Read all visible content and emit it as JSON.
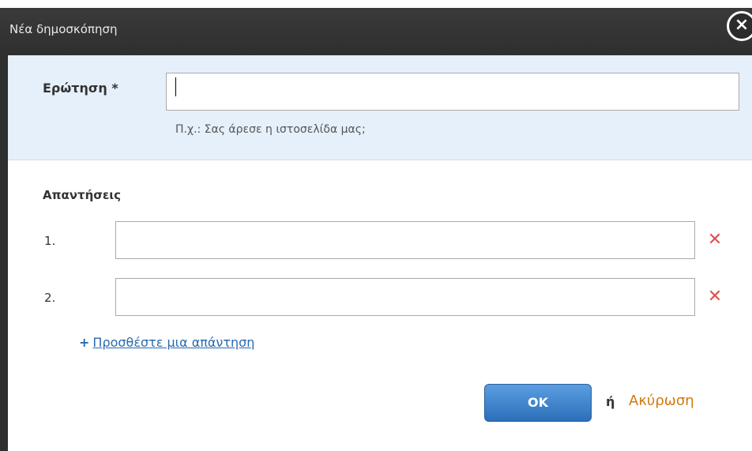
{
  "dialog": {
    "title": "Νέα δημοσκόπηση",
    "close_icon": "close-icon"
  },
  "question": {
    "label": "Ερώτηση *",
    "value": "",
    "hint": "Π.χ.: Σας άρεσε η ιστοσελίδα μας;"
  },
  "answers": {
    "heading": "Απαντήσεις",
    "items": [
      {
        "number": "1.",
        "value": "",
        "remove_icon": "remove-icon"
      },
      {
        "number": "2.",
        "value": "",
        "remove_icon": "remove-icon"
      }
    ],
    "add_link": "Προσθέστε μια απάντηση",
    "add_icon": "plus-icon"
  },
  "footer": {
    "ok_label": "OK",
    "or_text": "ή",
    "cancel_label": "Ακύρωση"
  },
  "colors": {
    "titlebar": "#333333",
    "question_bg": "#e6f0fb",
    "link": "#2a6ab0",
    "remove": "#e05050",
    "ok_button": "#3b7fcb",
    "cancel": "#d2790e"
  }
}
